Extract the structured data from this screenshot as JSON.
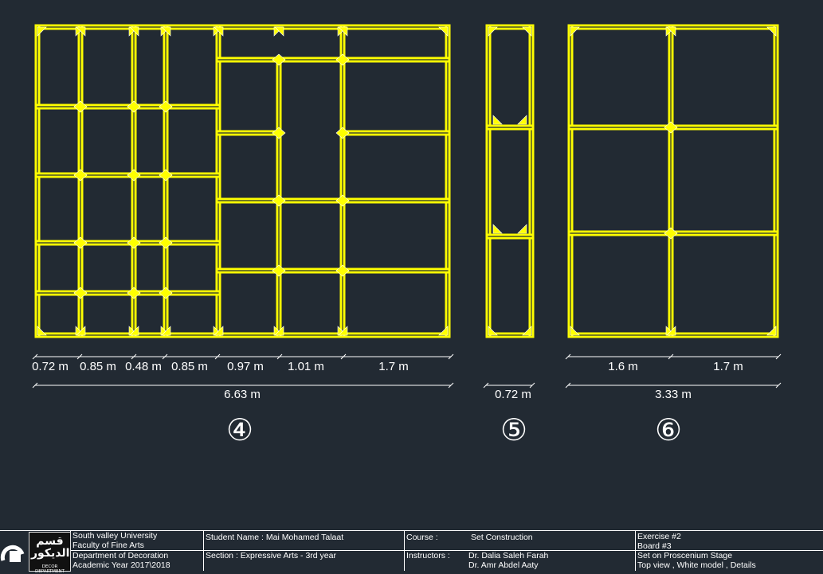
{
  "colors": {
    "background": "#222a33",
    "frame": "#ffff00",
    "line": "#ffffff"
  },
  "panels": [
    {
      "number": "④",
      "segments": [
        "0.72 m",
        "0.85 m",
        "0.48 m",
        "0.85 m",
        "0.97 m",
        "1.01 m",
        "1.7 m"
      ],
      "total": "6.63 m"
    },
    {
      "number": "⑤",
      "segments": [],
      "total": "0.72 m"
    },
    {
      "number": "⑥",
      "segments": [
        "1.6 m",
        "1.7 m"
      ],
      "total": "3.33 m"
    }
  ],
  "title_block": {
    "logo_text": "قسم الديكور",
    "logo_sub": "DECOR DEPARTMENT",
    "university": "South valley University",
    "faculty": "Faculty of Fine Arts",
    "department": "Department of Decoration",
    "academic_year": "Academic Year 2017\\2018",
    "student_name": "Student Name : Mai Mohamed Talaat",
    "section": "Section : Expressive Arts - 3rd year",
    "course_label": "Course :",
    "course": "Set Construction",
    "instructors_label": "Instructors :",
    "instructor_1": "Dr. Dalia Saleh Farah",
    "instructor_2": "Dr. Amr Abdel Aaty",
    "exercise": "Exercise #2",
    "board": "Board #3",
    "subject": "Set on Proscenium Stage",
    "views": "Top view , White model  , Details"
  }
}
